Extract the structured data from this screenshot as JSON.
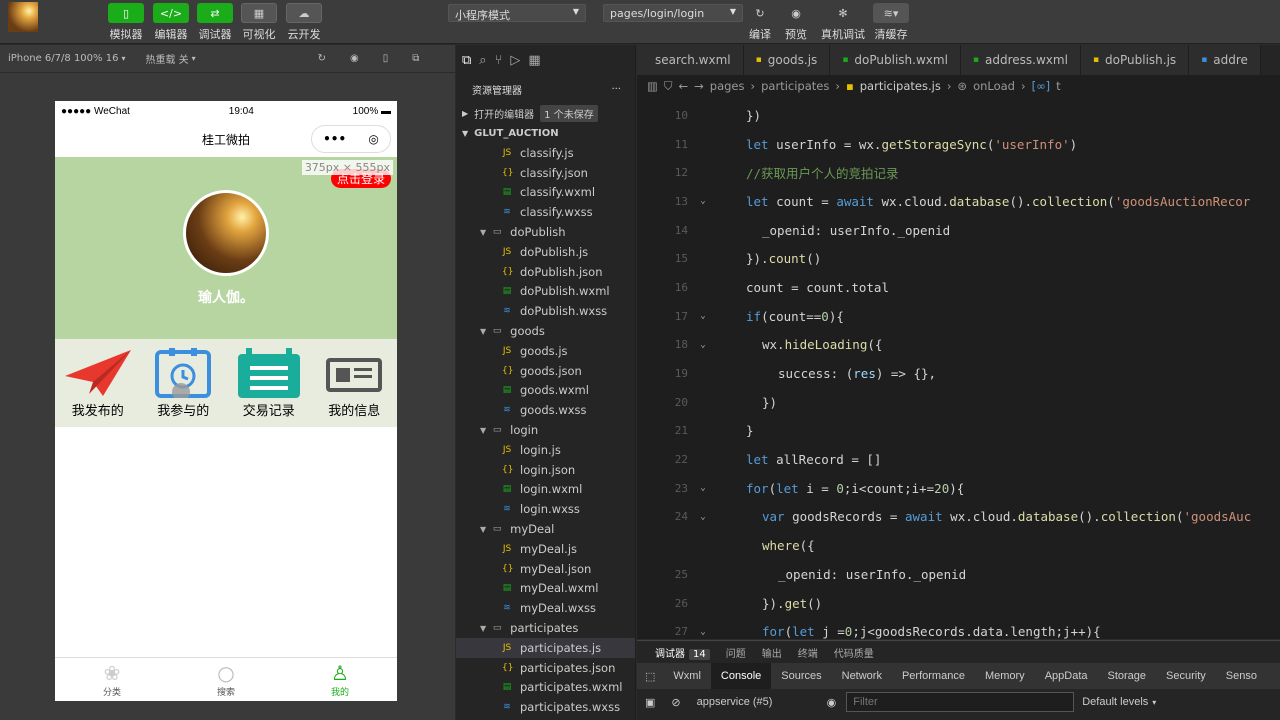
{
  "toolbar": {
    "buttons": [
      {
        "label": "模拟器",
        "icon": "phone-icon"
      },
      {
        "label": "编辑器",
        "icon": "code-icon"
      },
      {
        "label": "调试器",
        "icon": "debug-icon"
      },
      {
        "label": "可视化",
        "icon": "layout-icon"
      },
      {
        "label": "云开发",
        "icon": "cloud-icon"
      }
    ],
    "mode": "小程序模式",
    "path": "pages/login/login",
    "right_buttons": [
      {
        "label": "编译",
        "icon": "refresh-icon"
      },
      {
        "label": "预览",
        "icon": "eye-icon"
      },
      {
        "label": "真机调试",
        "icon": "bug-icon"
      },
      {
        "label": "清缓存",
        "icon": "layers-icon"
      }
    ]
  },
  "simulator": {
    "device": "iPhone 6/7/8 100% 16",
    "hot_reload": "热重载 关",
    "status": {
      "carrier": "●●●●● WeChat",
      "time": "19:04",
      "battery": "100%"
    },
    "nav_title": "桂工微拍",
    "size_tag": "375px × 555px",
    "login_button": "点击登录",
    "username": "瑜人伽。",
    "menu": [
      "我发布的",
      "我参与的",
      "交易记录",
      "我的信息"
    ],
    "tabs": [
      "分类",
      "搜索",
      "我的"
    ]
  },
  "explorer": {
    "title": "资源管理器",
    "open_editors": "打开的编辑器",
    "unsaved": "1 个未保存",
    "project": "GLUT_AUCTION",
    "rows": [
      {
        "name": "classify.js",
        "type": "js",
        "folder": false
      },
      {
        "name": "classify.json",
        "type": "json",
        "folder": false
      },
      {
        "name": "classify.wxml",
        "type": "wxml",
        "folder": false
      },
      {
        "name": "classify.wxss",
        "type": "wxss",
        "folder": false
      },
      {
        "name": "doPublish",
        "type": "folder",
        "folder": true
      },
      {
        "name": "doPublish.js",
        "type": "js",
        "folder": false
      },
      {
        "name": "doPublish.json",
        "type": "json",
        "folder": false
      },
      {
        "name": "doPublish.wxml",
        "type": "wxml",
        "folder": false
      },
      {
        "name": "doPublish.wxss",
        "type": "wxss",
        "folder": false
      },
      {
        "name": "goods",
        "type": "folder",
        "folder": true
      },
      {
        "name": "goods.js",
        "type": "js",
        "folder": false
      },
      {
        "name": "goods.json",
        "type": "json",
        "folder": false
      },
      {
        "name": "goods.wxml",
        "type": "wxml",
        "folder": false
      },
      {
        "name": "goods.wxss",
        "type": "wxss",
        "folder": false
      },
      {
        "name": "login",
        "type": "folder",
        "folder": true
      },
      {
        "name": "login.js",
        "type": "js",
        "folder": false
      },
      {
        "name": "login.json",
        "type": "json",
        "folder": false
      },
      {
        "name": "login.wxml",
        "type": "wxml",
        "folder": false
      },
      {
        "name": "login.wxss",
        "type": "wxss",
        "folder": false
      },
      {
        "name": "myDeal",
        "type": "folder",
        "folder": true
      },
      {
        "name": "myDeal.js",
        "type": "js",
        "folder": false
      },
      {
        "name": "myDeal.json",
        "type": "json",
        "folder": false
      },
      {
        "name": "myDeal.wxml",
        "type": "wxml",
        "folder": false
      },
      {
        "name": "myDeal.wxss",
        "type": "wxss",
        "folder": false
      },
      {
        "name": "participates",
        "type": "folder",
        "folder": true
      },
      {
        "name": "participates.js",
        "type": "js",
        "folder": false,
        "selected": true
      },
      {
        "name": "participates.json",
        "type": "json",
        "folder": false
      },
      {
        "name": "participates.wxml",
        "type": "wxml",
        "folder": false
      },
      {
        "name": "participates.wxss",
        "type": "wxss",
        "folder": false
      }
    ]
  },
  "editor": {
    "tabs": [
      "search.wxml",
      "goods.js",
      "doPublish.wxml",
      "address.wxml",
      "doPublish.js",
      "addre"
    ],
    "breadcrumb": [
      "pages",
      "participates",
      "participates.js",
      "onLoad",
      "t"
    ],
    "lines": [
      {
        "n": "10",
        "fold": "",
        "indent": 0,
        "html": "})"
      },
      {
        "n": "11",
        "fold": "",
        "indent": 0,
        "html": "<span class=\"kw\">let</span> userInfo = wx.<span class=\"fn\">getStorageSync</span>(<span class=\"str\">'userInfo'</span>)"
      },
      {
        "n": "12",
        "fold": "",
        "indent": 0,
        "html": "<span class=\"cm\">//获取用户个人的竞拍记录</span>"
      },
      {
        "n": "13",
        "fold": "⌄",
        "indent": 0,
        "html": "<span class=\"kw\">let</span> count = <span class=\"kw\">await</span> wx.cloud.<span class=\"fn\">database</span>().<span class=\"fn\">collection</span>(<span class=\"str\">'goodsAuctionRecor</span>"
      },
      {
        "n": "14",
        "fold": "",
        "indent": 1,
        "html": "_openid: userInfo._openid"
      },
      {
        "n": "15",
        "fold": "",
        "indent": 0,
        "html": "}).<span class=\"fn\">count</span>()"
      },
      {
        "n": "16",
        "fold": "",
        "indent": 0,
        "html": "count = count.total"
      },
      {
        "n": "17",
        "fold": "⌄",
        "indent": 0,
        "html": "<span class=\"kw\">if</span>(count==<span class=\"num\">0</span>){"
      },
      {
        "n": "18",
        "fold": "⌄",
        "indent": 1,
        "html": "wx.<span class=\"fn\">hideLoading</span>({"
      },
      {
        "n": "19",
        "fold": "",
        "indent": 2,
        "html": "success: (<span class=\"var\">res</span>) => {},"
      },
      {
        "n": "20",
        "fold": "",
        "indent": 1,
        "html": "})"
      },
      {
        "n": "21",
        "fold": "",
        "indent": 0,
        "html": "}"
      },
      {
        "n": "22",
        "fold": "",
        "indent": 0,
        "html": "<span class=\"kw\">let</span> allRecord = []"
      },
      {
        "n": "23",
        "fold": "⌄",
        "indent": 0,
        "html": "<span class=\"kw\">for</span>(<span class=\"kw\">let</span> i = <span class=\"num\">0</span>;i&lt;count;i+=<span class=\"num\">20</span>){"
      },
      {
        "n": "24",
        "fold": "⌄",
        "indent": 1,
        "html": "<span class=\"kw\">var</span> goodsRecords = <span class=\"kw\">await</span> wx.cloud.<span class=\"fn\">database</span>().<span class=\"fn\">collection</span>(<span class=\"str\">'goodsAuc</span>"
      },
      {
        "n": "",
        "fold": "",
        "indent": 1,
        "html": "<span class=\"fn\">where</span>({"
      },
      {
        "n": "25",
        "fold": "",
        "indent": 2,
        "html": "_openid: userInfo._openid"
      },
      {
        "n": "26",
        "fold": "",
        "indent": 1,
        "html": "}).<span class=\"fn\">get</span>()"
      },
      {
        "n": "27",
        "fold": "⌄",
        "indent": 1,
        "html": "<span class=\"kw\">for</span>(<span class=\"kw\">let</span> j =<span class=\"num\">0</span>;j&lt;goodsRecords.data.length;j++){"
      }
    ]
  },
  "debug": {
    "tabs": [
      "调试器",
      "问题",
      "输出",
      "终端",
      "代码质量"
    ],
    "count": "14",
    "panels": [
      "Wxml",
      "Console",
      "Sources",
      "Network",
      "Performance",
      "Memory",
      "AppData",
      "Storage",
      "Security",
      "Senso"
    ],
    "context": "appservice (#5)",
    "filter_placeholder": "Filter",
    "levels": "Default levels"
  }
}
